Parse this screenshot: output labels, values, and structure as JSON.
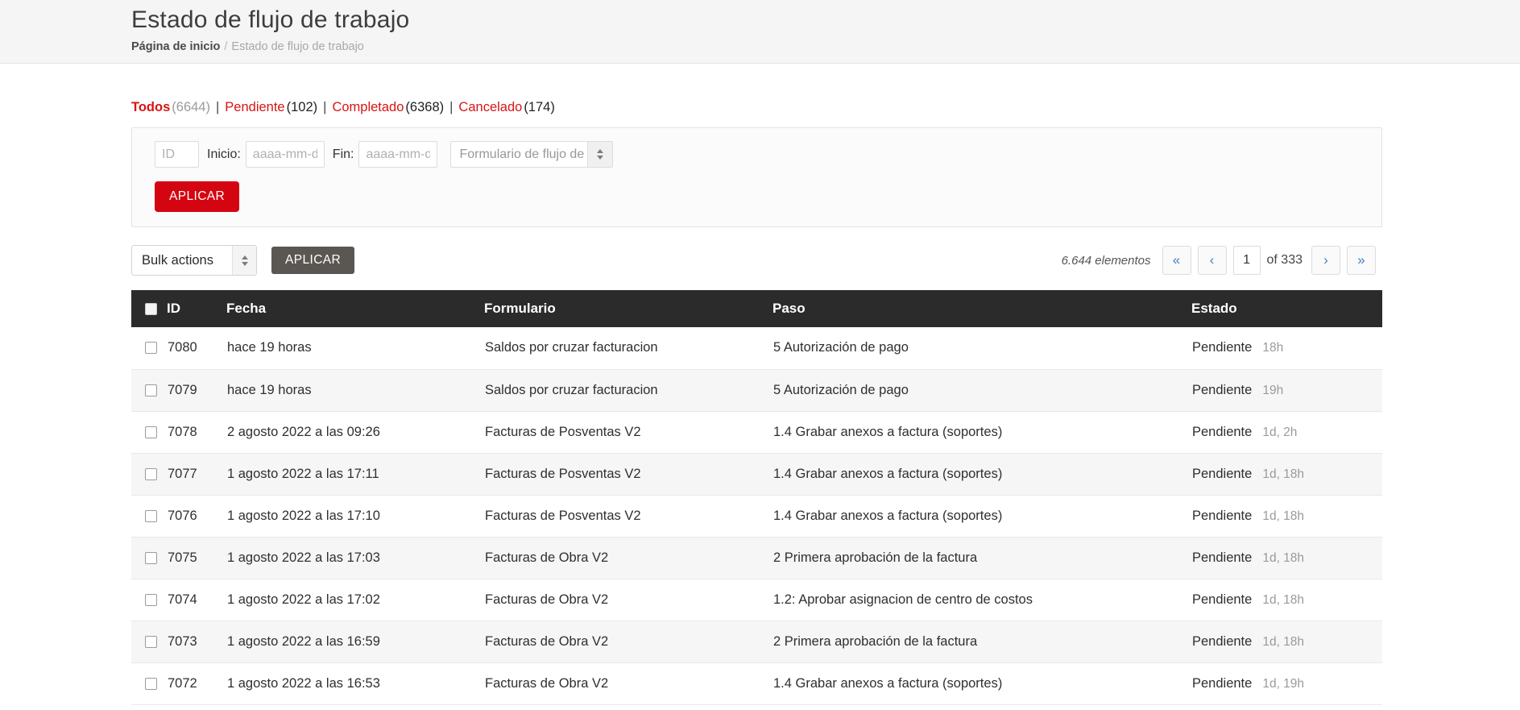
{
  "header": {
    "title": "Estado de flujo de trabajo",
    "breadcrumb_home": "Página de inicio",
    "breadcrumb_sep": "/",
    "breadcrumb_current": "Estado de flujo de trabajo"
  },
  "status_links": [
    {
      "label": "Todos",
      "count": "(6644)",
      "active": true
    },
    {
      "label": "Pendiente",
      "count": "(102)",
      "active": false
    },
    {
      "label": "Completado",
      "count": "(6368)",
      "active": false
    },
    {
      "label": "Cancelado",
      "count": "(174)",
      "active": false
    }
  ],
  "separator": "|",
  "filters": {
    "id_placeholder": "ID",
    "id_value": "",
    "start_label": "Inicio:",
    "start_placeholder": "aaaa-mm-d",
    "start_value": "",
    "end_label": "Fin:",
    "end_placeholder": "aaaa-mm-d",
    "end_value": "",
    "form_select_value": "Formulario de flujo de",
    "apply_label": "APLICAR"
  },
  "bulk": {
    "select_value": "Bulk actions",
    "apply_label": "APLICAR"
  },
  "pagination": {
    "items_text": "6.644 elementos",
    "first": "«",
    "prev": "‹",
    "current_page": "1",
    "of_text": "of 333",
    "next": "›",
    "last": "»"
  },
  "table": {
    "columns": [
      "ID",
      "Fecha",
      "Formulario",
      "Paso",
      "Estado"
    ],
    "rows": [
      {
        "id": "7080",
        "fecha": "hace 19 horas",
        "formulario": "Saldos por cruzar facturacion",
        "paso": "5 Autorización de pago",
        "estado": "Pendiente",
        "age": "18h"
      },
      {
        "id": "7079",
        "fecha": "hace 19 horas",
        "formulario": "Saldos por cruzar facturacion",
        "paso": "5 Autorización de pago",
        "estado": "Pendiente",
        "age": "19h"
      },
      {
        "id": "7078",
        "fecha": "2 agosto 2022 a las 09:26",
        "formulario": "Facturas de Posventas V2",
        "paso": "1.4 Grabar anexos a factura (soportes)",
        "estado": "Pendiente",
        "age": "1d, 2h"
      },
      {
        "id": "7077",
        "fecha": "1 agosto 2022 a las 17:11",
        "formulario": "Facturas de Posventas V2",
        "paso": "1.4 Grabar anexos a factura (soportes)",
        "estado": "Pendiente",
        "age": "1d, 18h"
      },
      {
        "id": "7076",
        "fecha": "1 agosto 2022 a las 17:10",
        "formulario": "Facturas de Posventas V2",
        "paso": "1.4 Grabar anexos a factura (soportes)",
        "estado": "Pendiente",
        "age": "1d, 18h"
      },
      {
        "id": "7075",
        "fecha": "1 agosto 2022 a las 17:03",
        "formulario": "Facturas de Obra V2",
        "paso": "2 Primera aprobación de la factura",
        "estado": "Pendiente",
        "age": "1d, 18h"
      },
      {
        "id": "7074",
        "fecha": "1 agosto 2022 a las 17:02",
        "formulario": "Facturas de Obra V2",
        "paso": "1.2: Aprobar asignacion de centro de costos",
        "estado": "Pendiente",
        "age": "1d, 18h"
      },
      {
        "id": "7073",
        "fecha": "1 agosto 2022 a las 16:59",
        "formulario": "Facturas de Obra V2",
        "paso": "2 Primera aprobación de la factura",
        "estado": "Pendiente",
        "age": "1d, 18h"
      },
      {
        "id": "7072",
        "fecha": "1 agosto 2022 a las 16:53",
        "formulario": "Facturas de Obra V2",
        "paso": "1.4 Grabar anexos a factura (soportes)",
        "estado": "Pendiente",
        "age": "1d, 19h"
      }
    ]
  },
  "colors": {
    "accent_red": "#d40511",
    "link_red": "#d81414",
    "header_dark": "#2b2b2b",
    "band_grey": "#f5f5f5",
    "pager_blue": "#3d7fc1"
  }
}
